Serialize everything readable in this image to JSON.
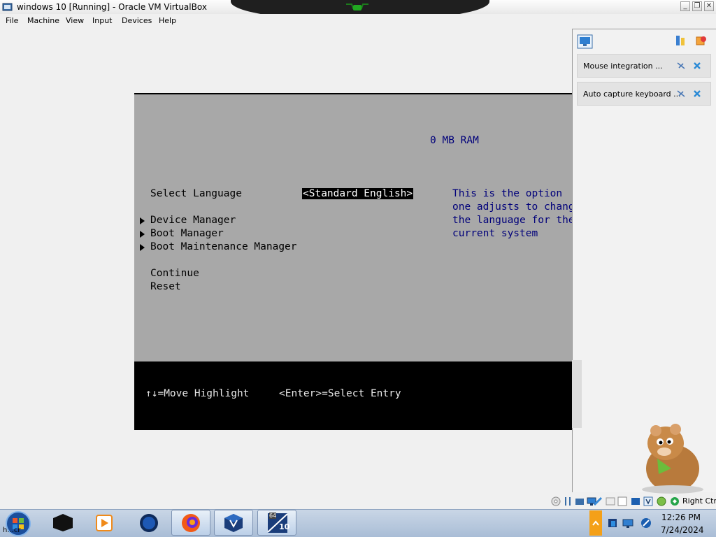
{
  "window": {
    "title": "windows 10 [Running] - Oracle VM VirtualBox",
    "controls": [
      "minimize",
      "restore",
      "close"
    ]
  },
  "menubar": [
    "File",
    "Machine",
    "View",
    "Input",
    "Devices",
    "Help"
  ],
  "bios": {
    "ram": "0 MB RAM",
    "language_label": "Select Language",
    "language_value": "<Standard English>",
    "help_lines": [
      "This is the option",
      "one adjusts to change",
      "the language for the",
      "current system"
    ],
    "submenus": [
      "Device Manager",
      "Boot Manager",
      "Boot Maintenance Manager"
    ],
    "actions": [
      "Continue",
      "Reset"
    ],
    "footer": {
      "move": "↑↓=Move Highlight",
      "select": "<Enter>=Select Entry"
    },
    "colors": {
      "background": "#a8a8a8",
      "help_text": "#00007a",
      "footer": "#000000"
    }
  },
  "side_panel": {
    "notifications": [
      {
        "text": "Mouse integration ..."
      },
      {
        "text": "Auto capture keyboard ..."
      }
    ]
  },
  "statusbar": {
    "host_key": "Right Ctrl",
    "icons": [
      "optical-disk-icon",
      "usb-icon",
      "shared-folders-icon",
      "display-icon",
      "network-icon",
      "hard-disk-icon",
      "audio-icon",
      "capture-icon",
      "mouse-integration-icon",
      "keyboard-icon"
    ]
  },
  "taskbar": {
    "start_label": "h...cr",
    "apps": [
      "terminal-app",
      "media-player-app",
      "globe-app",
      "firefox-app",
      "virtualbox-app",
      "virtualbox-win10-app"
    ],
    "active_app_badge": "64",
    "active_app_label": "10",
    "time": "12:26 PM",
    "date": "7/24/2024"
  }
}
